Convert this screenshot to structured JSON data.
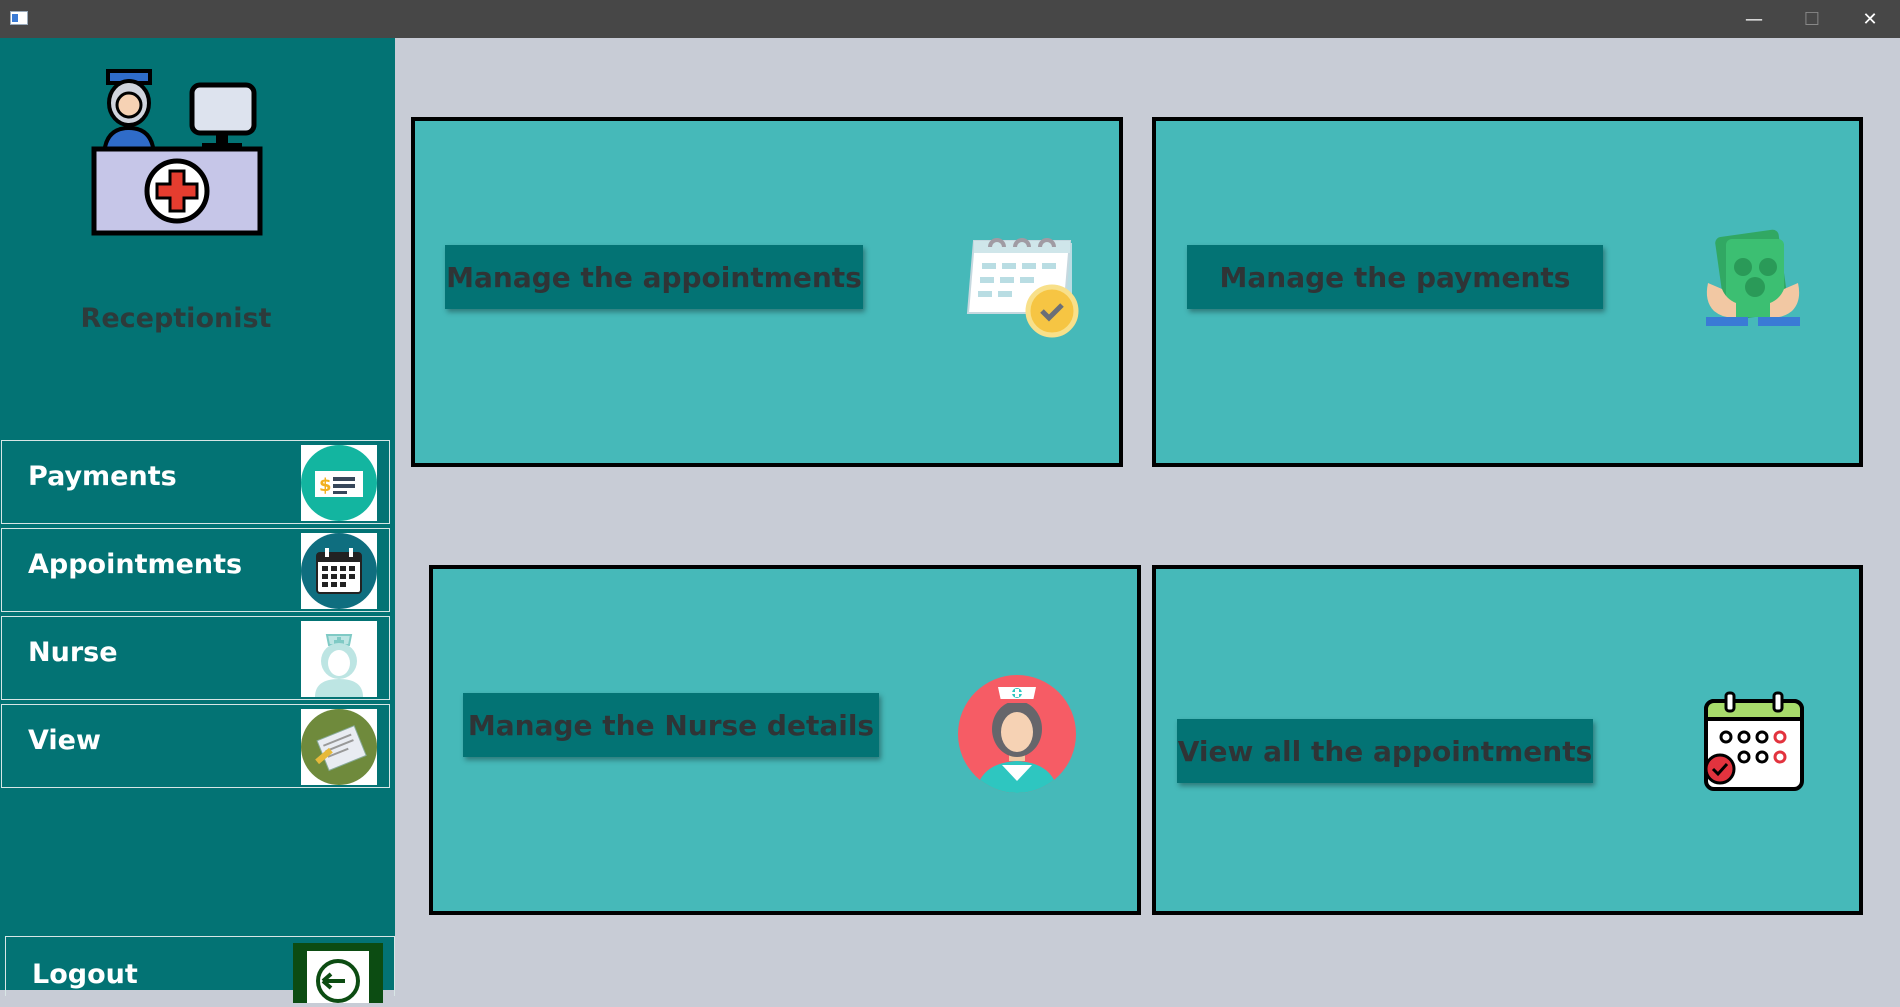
{
  "window": {
    "controls": [
      "—",
      "☐",
      "✕"
    ]
  },
  "sidebar": {
    "role": "Receptionist",
    "items": [
      {
        "label": "Payments",
        "icon": "payment-check-icon"
      },
      {
        "label": "Appointments",
        "icon": "calendar-icon"
      },
      {
        "label": "Nurse",
        "icon": "nurse-icon"
      },
      {
        "label": "View",
        "icon": "document-view-icon"
      }
    ],
    "logout": {
      "label": "Logout",
      "icon": "logout-icon"
    }
  },
  "cards": [
    {
      "button": "Manage the appointments",
      "icon": "calendar-check-icon"
    },
    {
      "button": "Manage the payments",
      "icon": "money-hands-icon"
    },
    {
      "button": "Manage the Nurse details",
      "icon": "nurse-avatar-icon"
    },
    {
      "button": "View all the appointments",
      "icon": "calendar-grid-icon"
    }
  ],
  "colors": {
    "sidebar": "#037374",
    "card": "#46b9b9",
    "background": "#c8ccd6",
    "titlebar": "#474747"
  }
}
